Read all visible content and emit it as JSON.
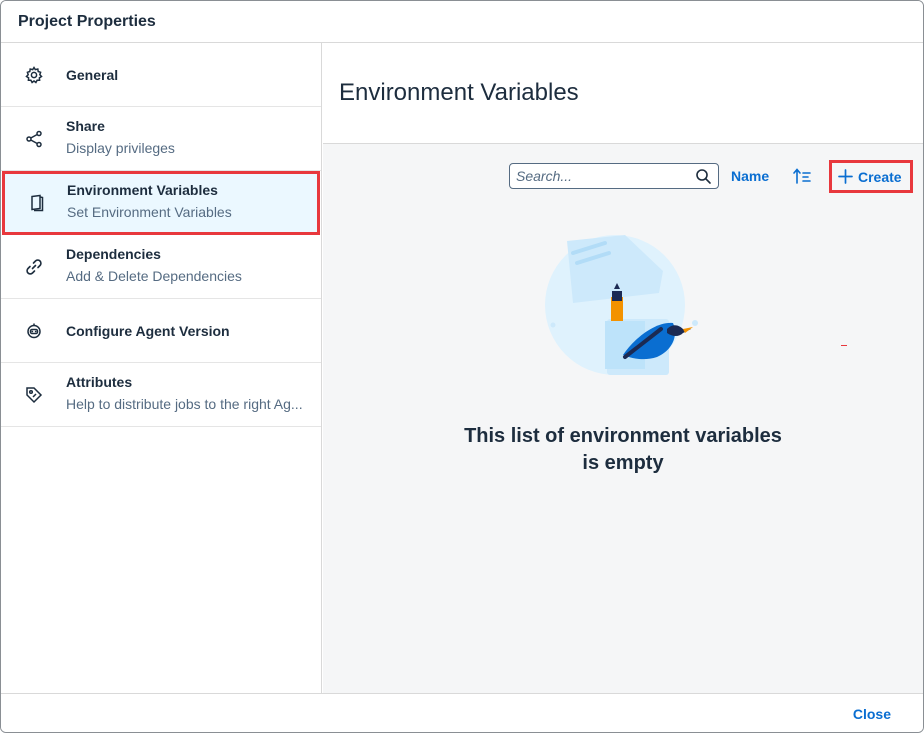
{
  "dialog": {
    "title": "Project Properties"
  },
  "sidebar": {
    "items": [
      {
        "label": "General",
        "subtitle": "",
        "icon": "gear-icon"
      },
      {
        "label": "Share",
        "subtitle": "Display privileges",
        "icon": "share-icon"
      },
      {
        "label": "Environment Variables",
        "subtitle": "Set Environment Variables",
        "icon": "book-icon",
        "selected": true
      },
      {
        "label": "Dependencies",
        "subtitle": "Add & Delete Dependencies",
        "icon": "link-icon"
      },
      {
        "label": "Configure Agent Version",
        "subtitle": "",
        "icon": "agent-icon"
      },
      {
        "label": "Attributes",
        "subtitle": "Help to distribute jobs to the right Ag...",
        "icon": "tag-icon"
      }
    ]
  },
  "content": {
    "title": "Environment Variables",
    "toolbar": {
      "search_placeholder": "Search...",
      "sort_label": "Name",
      "create_label": "Create"
    },
    "empty_message_line1": "This list of environment variables",
    "empty_message_line2": "is empty"
  },
  "footer": {
    "close_label": "Close"
  },
  "colors": {
    "accent": "#0a6ed1",
    "highlight": "#e8383d",
    "selected_bg": "#ebf8ff",
    "text": "#1d2d3e",
    "subtext": "#556b82"
  }
}
